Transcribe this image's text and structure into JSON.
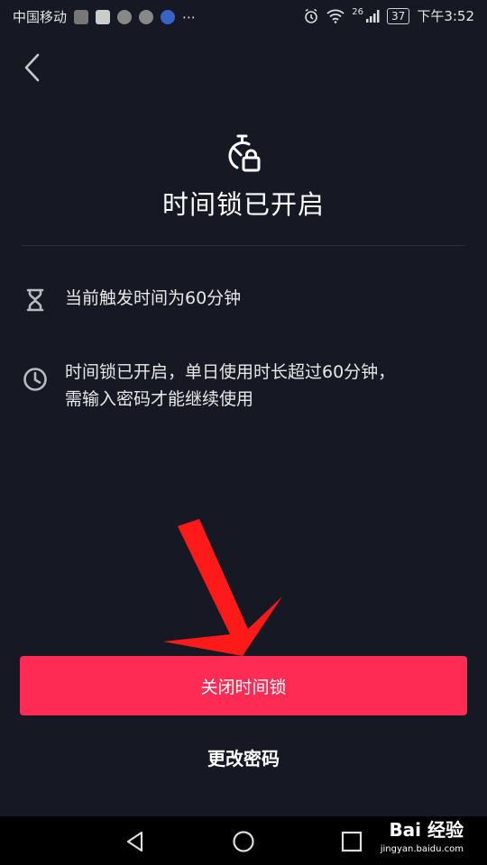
{
  "status_bar": {
    "carrier": "中国移动",
    "dots": "⋯",
    "network": "26",
    "battery": "37",
    "time": "下午3:52"
  },
  "page": {
    "title": "时间锁已开启",
    "items": [
      {
        "icon": "hourglass-icon",
        "text": "当前触发时间为60分钟"
      },
      {
        "icon": "clock-icon",
        "line1": "时间锁已开启，单日使用时长超过60分钟，",
        "line2": "需输入密码才能继续使用"
      }
    ],
    "primary_button": "关闭时间锁",
    "secondary_button": "更改密码"
  },
  "watermark": {
    "brand": "Bai 经验",
    "url": "jingyan.baidu.com"
  },
  "colors": {
    "background": "#161823",
    "accent": "#fe2c55",
    "arrow": "#ff1a1a"
  }
}
